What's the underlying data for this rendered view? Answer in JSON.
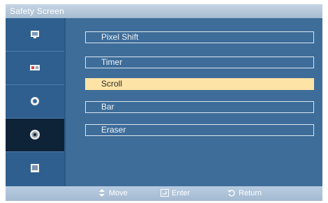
{
  "title": "Safety Screen",
  "sidebar": {
    "items": [
      {
        "icon": "picture-icon"
      },
      {
        "icon": "sound-icon"
      },
      {
        "icon": "setup-icon"
      },
      {
        "icon": "gear-icon",
        "active": true
      },
      {
        "icon": "multi-control-icon"
      }
    ]
  },
  "menu": {
    "items": [
      {
        "label": "Pixel Shift"
      },
      {
        "label": "Timer"
      },
      {
        "label": "Scroll",
        "selected": true
      },
      {
        "label": "Bar"
      },
      {
        "label": "Eraser"
      }
    ]
  },
  "footer": {
    "move": "Move",
    "enter": "Enter",
    "return": "Return"
  },
  "colors": {
    "panel": "#3e6d99",
    "sidebar": "#2f5f8e",
    "active_sidebar": "#0e2238",
    "selected_item": "#fde3a6",
    "title_bar": "#b5c8dc"
  }
}
